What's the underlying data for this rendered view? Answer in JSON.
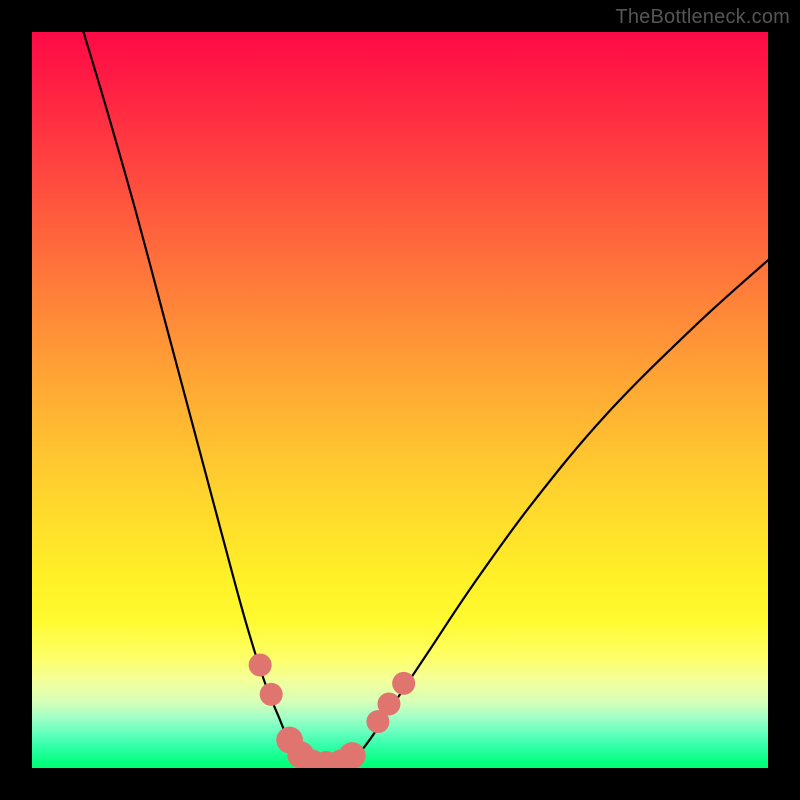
{
  "watermark": {
    "text": "TheBottleneck.com"
  },
  "colors": {
    "frame": "#000000",
    "curve": "#000000",
    "marker_fill": "#e0746f",
    "marker_stroke": "#c95a55",
    "gradient_top": "#ff0a47",
    "gradient_bottom": "#00ff72"
  },
  "chart_data": {
    "type": "line",
    "title": "",
    "xlabel": "",
    "ylabel": "",
    "xlim": [
      0,
      100
    ],
    "ylim": [
      0,
      100
    ],
    "grid": false,
    "series": [
      {
        "name": "left-curve",
        "x": [
          7,
          10,
          14,
          18,
          22,
          26,
          29,
          31.5,
          33.5,
          35,
          36.5,
          37.5
        ],
        "y": [
          100,
          90,
          76,
          61,
          46,
          31,
          20,
          12,
          7,
          3.5,
          1.5,
          0.4
        ]
      },
      {
        "name": "right-curve",
        "x": [
          42.5,
          44,
          46,
          49,
          54,
          60,
          68,
          78,
          90,
          100
        ],
        "y": [
          0.4,
          1.5,
          4,
          8.5,
          16,
          25,
          36,
          48,
          60,
          69
        ]
      },
      {
        "name": "valley-floor",
        "x": [
          37.5,
          38.5,
          40,
          41.5,
          42.5
        ],
        "y": [
          0.4,
          0.15,
          0.1,
          0.15,
          0.4
        ]
      }
    ],
    "markers": [
      {
        "x": 31.0,
        "y": 14.0,
        "r": 1.5
      },
      {
        "x": 32.5,
        "y": 10.0,
        "r": 1.5
      },
      {
        "x": 35.0,
        "y": 3.8,
        "r": 2.0
      },
      {
        "x": 36.5,
        "y": 1.8,
        "r": 2.0
      },
      {
        "x": 38.0,
        "y": 0.7,
        "r": 2.0
      },
      {
        "x": 40.0,
        "y": 0.5,
        "r": 2.0
      },
      {
        "x": 42.0,
        "y": 0.7,
        "r": 2.0
      },
      {
        "x": 43.5,
        "y": 1.7,
        "r": 2.0
      },
      {
        "x": 47.0,
        "y": 6.3,
        "r": 1.5
      },
      {
        "x": 48.5,
        "y": 8.7,
        "r": 1.5
      },
      {
        "x": 50.5,
        "y": 11.5,
        "r": 1.5
      }
    ]
  }
}
